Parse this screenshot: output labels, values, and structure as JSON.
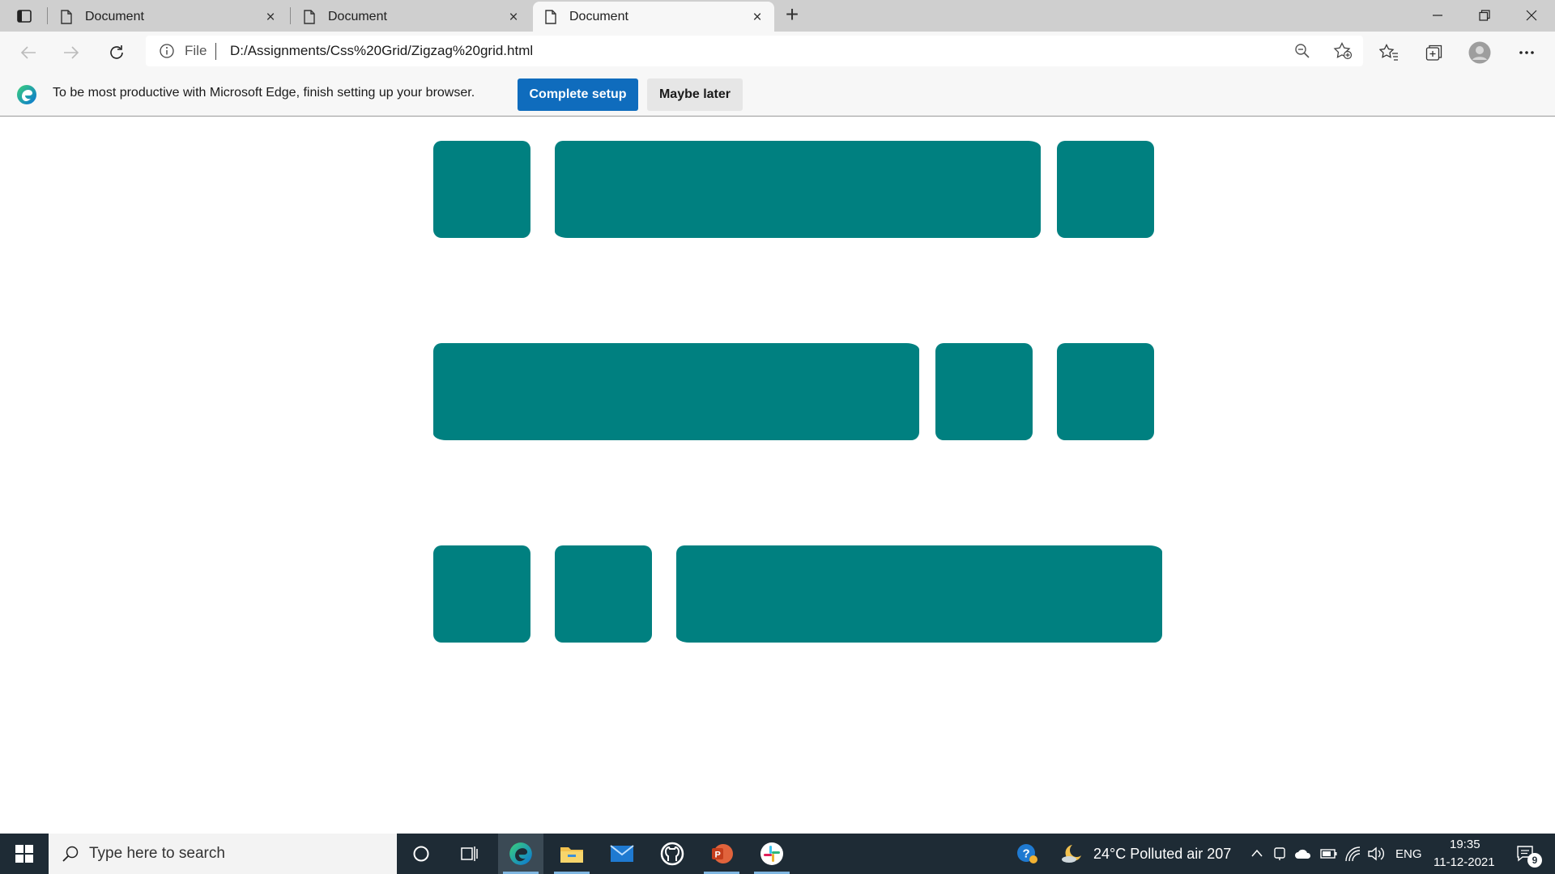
{
  "browser": {
    "tabs": [
      {
        "title": "Document",
        "close": "×"
      },
      {
        "title": "Document",
        "close": "×"
      },
      {
        "title": "Document",
        "close": "×"
      }
    ],
    "new_tab_label": "+",
    "address": {
      "scheme_label": "File",
      "url": "D:/Assignments/Css%20Grid/Zigzag%20grid.html"
    }
  },
  "infobar": {
    "message": "To be most productive with Microsoft Edge, finish setting up your browser.",
    "primary_button": "Complete setup",
    "secondary_button": "Maybe later"
  },
  "page": {
    "box_color": "#008080",
    "rows": [
      [
        "small",
        "wide",
        "small"
      ],
      [
        "wide",
        "small",
        "small"
      ],
      [
        "small",
        "small",
        "wide"
      ]
    ]
  },
  "taskbar": {
    "search_placeholder": "Type here to search",
    "weather": "24°C  Polluted air 207",
    "language": "ENG",
    "time": "19:35",
    "date": "11-12-2021",
    "notification_count": "9",
    "apps": [
      "cortana-icon",
      "task-view-icon",
      "edge-icon",
      "file-explorer-icon",
      "mail-icon",
      "github-desktop-icon",
      "powerpoint-icon",
      "slack-icon"
    ]
  }
}
